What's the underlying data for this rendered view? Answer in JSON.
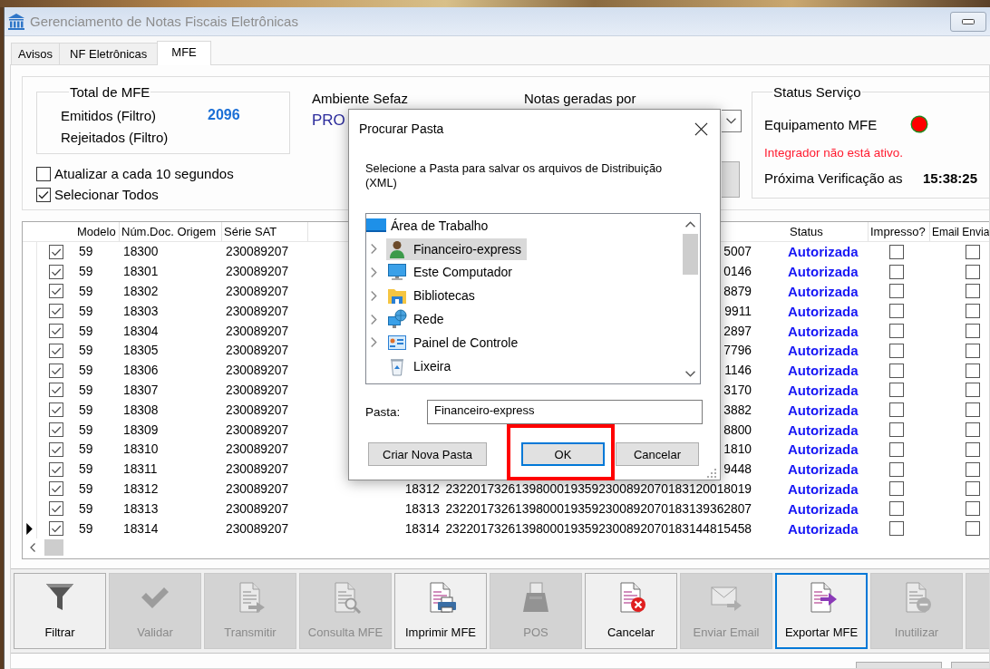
{
  "window": {
    "title": "Gerenciamento de Notas Fiscais Eletrônicas"
  },
  "tabs": [
    {
      "label": "Avisos",
      "selected": false
    },
    {
      "label": "NF Eletrônicas",
      "selected": false
    },
    {
      "label": "MFE",
      "selected": true
    }
  ],
  "totals": {
    "title": "Total de MFE",
    "rows": [
      {
        "label": "Emitidos (Filtro)",
        "value": "2096"
      },
      {
        "label": "Rejeitados (Filtro)"
      }
    ]
  },
  "options": [
    {
      "label": "Atualizar a cada 10 segundos",
      "checked": false
    },
    {
      "label": "Selecionar Todos",
      "checked": true
    }
  ],
  "environment": {
    "label": "Ambiente Sefaz",
    "value": "PRO"
  },
  "generated_by": {
    "label": "Notas geradas por"
  },
  "service_status": {
    "title": "Status Serviço",
    "device": {
      "label": "Equipamento MFE",
      "online": false
    },
    "message": "Integrador não está ativo.",
    "next_check": {
      "label": "Próxima Verificação as",
      "time": "15:38:25"
    }
  },
  "table": {
    "columns": [
      "Modelo",
      "Núm.Doc. Origem",
      "Série SAT",
      "Status",
      "Impresso?",
      "Email Envia"
    ],
    "rows": [
      {
        "selected": false,
        "checked": true,
        "modelo": "59",
        "num_doc": "18300",
        "serie_sat": "230089207",
        "column_6": "5007",
        "status": "Autorizada",
        "printed": false,
        "email_sent": false
      },
      {
        "selected": false,
        "checked": true,
        "modelo": "59",
        "num_doc": "18301",
        "serie_sat": "230089207",
        "column_6": "0146",
        "status": "Autorizada",
        "printed": false,
        "email_sent": false
      },
      {
        "selected": false,
        "checked": true,
        "modelo": "59",
        "num_doc": "18302",
        "serie_sat": "230089207",
        "column_6": "8879",
        "status": "Autorizada",
        "printed": false,
        "email_sent": false
      },
      {
        "selected": false,
        "checked": true,
        "modelo": "59",
        "num_doc": "18303",
        "serie_sat": "230089207",
        "column_6": "9911",
        "status": "Autorizada",
        "printed": false,
        "email_sent": false
      },
      {
        "selected": false,
        "checked": true,
        "modelo": "59",
        "num_doc": "18304",
        "serie_sat": "230089207",
        "column_6": "2897",
        "status": "Autorizada",
        "printed": false,
        "email_sent": false
      },
      {
        "selected": false,
        "checked": true,
        "modelo": "59",
        "num_doc": "18305",
        "serie_sat": "230089207",
        "column_6": "7796",
        "status": "Autorizada",
        "printed": false,
        "email_sent": false
      },
      {
        "selected": false,
        "checked": true,
        "modelo": "59",
        "num_doc": "18306",
        "serie_sat": "230089207",
        "column_6": "1146",
        "status": "Autorizada",
        "printed": false,
        "email_sent": false
      },
      {
        "selected": false,
        "checked": true,
        "modelo": "59",
        "num_doc": "18307",
        "serie_sat": "230089207",
        "column_6": "3170",
        "status": "Autorizada",
        "printed": false,
        "email_sent": false
      },
      {
        "selected": false,
        "checked": true,
        "modelo": "59",
        "num_doc": "18308",
        "serie_sat": "230089207",
        "column_6": "3882",
        "status": "Autorizada",
        "printed": false,
        "email_sent": false
      },
      {
        "selected": false,
        "checked": true,
        "modelo": "59",
        "num_doc": "18309",
        "serie_sat": "230089207",
        "column_6": "8800",
        "status": "Autorizada",
        "printed": false,
        "email_sent": false
      },
      {
        "selected": false,
        "checked": true,
        "modelo": "59",
        "num_doc": "18310",
        "serie_sat": "230089207",
        "column_6": "1810",
        "status": "Autorizada",
        "printed": false,
        "email_sent": false
      },
      {
        "selected": false,
        "checked": true,
        "modelo": "59",
        "num_doc": "18311",
        "serie_sat": "230089207",
        "column_6": "9448",
        "status": "Autorizada",
        "printed": false,
        "email_sent": false
      },
      {
        "selected": false,
        "checked": true,
        "modelo": "59",
        "num_doc": "18312",
        "serie_sat": "230089207",
        "column_5": "18312",
        "column_6": "23220173261398000193592300892070183120018019",
        "status": "Autorizada",
        "printed": false,
        "email_sent": false
      },
      {
        "selected": false,
        "checked": true,
        "modelo": "59",
        "num_doc": "18313",
        "serie_sat": "230089207",
        "column_5": "18313",
        "column_6": "23220173261398000193592300892070183139362807",
        "status": "Autorizada",
        "printed": false,
        "email_sent": false
      },
      {
        "selected": true,
        "checked": true,
        "modelo": "59",
        "num_doc": "18314",
        "serie_sat": "230089207",
        "column_5": "18314",
        "column_6": "23220173261398000193592300892070183144815458",
        "status": "Autorizada",
        "printed": false,
        "email_sent": false
      }
    ]
  },
  "toolbar": [
    {
      "label": "Filtrar",
      "disabled": false,
      "focused": false
    },
    {
      "label": "Validar",
      "disabled": true,
      "focused": false
    },
    {
      "label": "Transmitir",
      "disabled": true,
      "focused": false
    },
    {
      "label": "Consulta MFE",
      "disabled": true,
      "focused": false
    },
    {
      "label": "Imprimir MFE",
      "disabled": false,
      "focused": false
    },
    {
      "label": "POS",
      "disabled": true,
      "focused": false
    },
    {
      "label": "Cancelar",
      "disabled": false,
      "focused": false
    },
    {
      "label": "Enviar Email",
      "disabled": true,
      "focused": false
    },
    {
      "label": "Exportar MFE",
      "disabled": false,
      "focused": true
    },
    {
      "label": "Inutilizar",
      "disabled": true,
      "focused": false
    },
    {
      "disabled": true,
      "focused": false
    }
  ],
  "dialog": {
    "title": "Procurar Pasta",
    "message": "Selecione a Pasta para salvar os arquivos de Distribuição (XML)",
    "tree": [
      {
        "label": "Área de Trabalho",
        "selected": false,
        "children": [
          {
            "label": "Financeiro-express",
            "selected": true,
            "expandable": true
          },
          {
            "label": "Este Computador",
            "selected": false,
            "expandable": true
          },
          {
            "label": "Bibliotecas",
            "selected": false,
            "expandable": true
          },
          {
            "label": "Rede",
            "selected": false,
            "expandable": true
          },
          {
            "label": "Painel de Controle",
            "selected": false,
            "expandable": true
          },
          {
            "label": "Lixeira",
            "selected": false,
            "expandable": false
          }
        ]
      }
    ],
    "folder": {
      "label": "Pasta:",
      "value": "Financeiro-express"
    },
    "buttons": [
      {
        "label": "Criar Nova Pasta",
        "default": false,
        "highlighted": false
      },
      {
        "label": "OK",
        "default": true,
        "highlighted": true
      },
      {
        "label": "Cancelar",
        "default": false,
        "highlighted": false
      }
    ]
  }
}
